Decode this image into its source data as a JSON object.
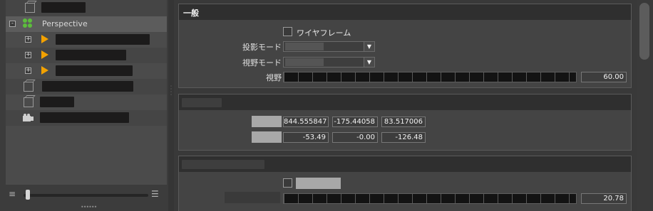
{
  "tree": {
    "rows": [
      {
        "type": "mesh",
        "selected": false
      },
      {
        "type": "group",
        "label": "Perspective",
        "selected": true
      },
      {
        "type": "light-child",
        "selected": false
      },
      {
        "type": "light-child",
        "selected": false
      },
      {
        "type": "light-child",
        "selected": false
      },
      {
        "type": "mesh",
        "selected": false
      },
      {
        "type": "mesh",
        "selected": false
      },
      {
        "type": "camera",
        "selected": false
      }
    ],
    "expander_symbol": "+",
    "icon_colors": {
      "group": "#5cbd3c",
      "light": "#f2a100"
    }
  },
  "general": {
    "title": "一般",
    "wireframe_label": "ワイヤフレーム",
    "projection_label": "投影モード",
    "view_mode_label": "視野モード",
    "fov_label": "視野",
    "fov_value": "60.00",
    "dropdown_arrow": "▼"
  },
  "transform": {
    "position": [
      "844.555847",
      "-175.44058",
      "83.517006"
    ],
    "rotation": [
      "-53.49",
      "-0.00",
      "-126.48"
    ]
  },
  "section3": {
    "value": "20.78"
  },
  "icons": {
    "tree_slider_left": "list-icon",
    "tree_slider_right": "list-indent-icon"
  },
  "colors": {
    "panel_bg": "#3b3b3b",
    "section_header_bg": "#2f2f2f",
    "selection_bg": "#5c5c5c"
  }
}
